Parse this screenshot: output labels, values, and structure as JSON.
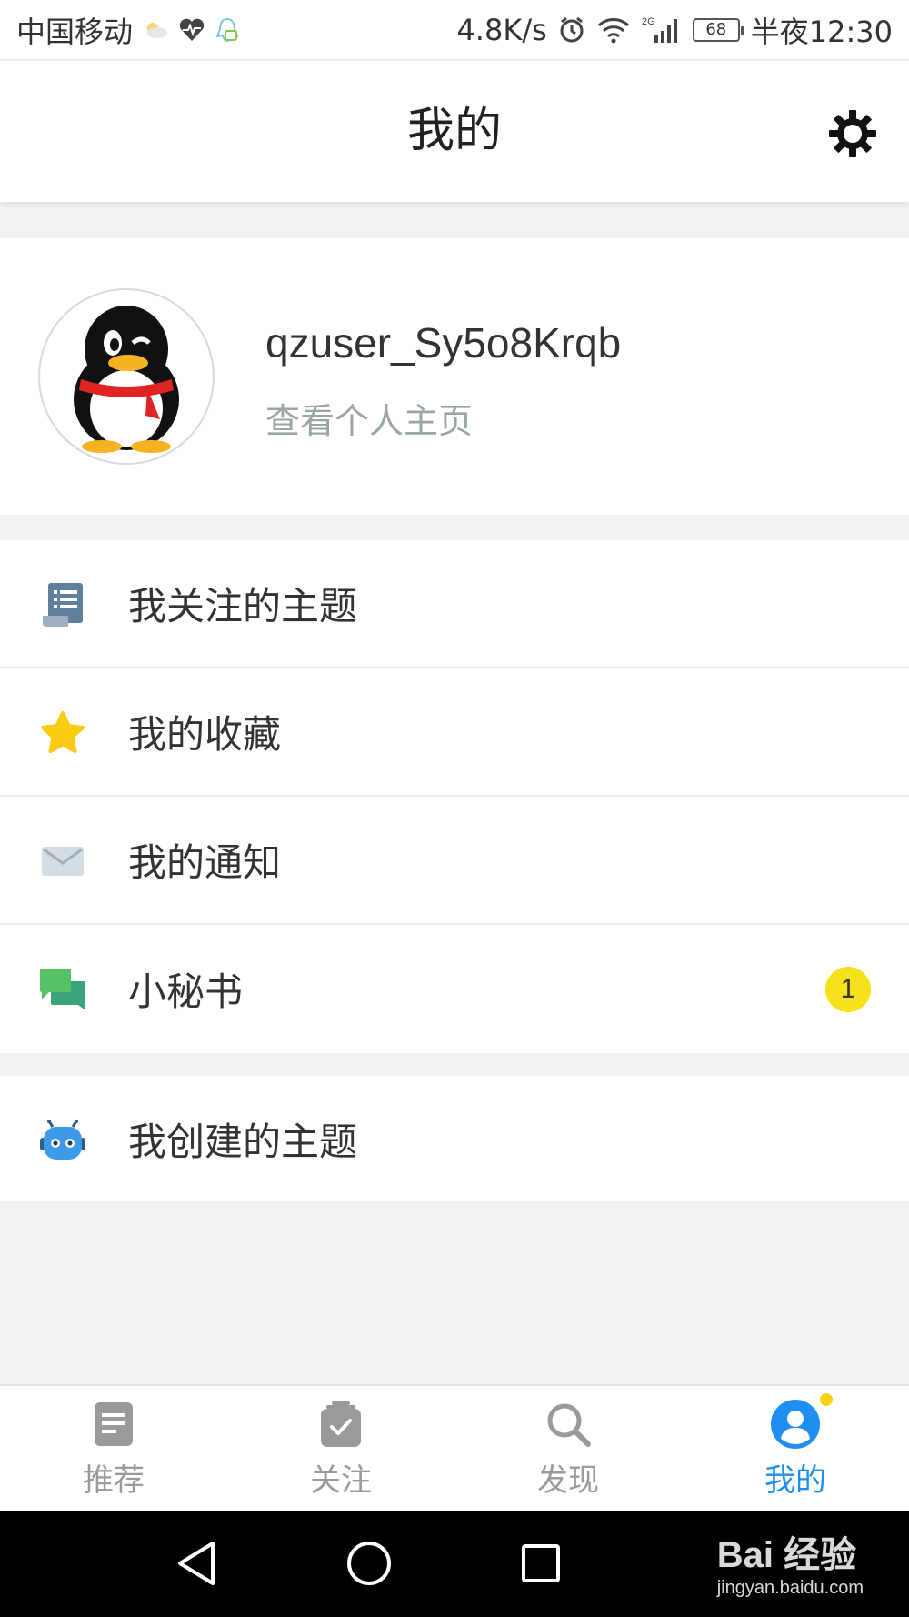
{
  "status_bar": {
    "carrier": "中国移动",
    "net_speed": "4.8K/s",
    "network_type": "2G",
    "battery": "68",
    "time": "半夜12:30",
    "icons": [
      "weather-icon",
      "heart-rate-icon",
      "qq-icon",
      "alarm-icon",
      "wifi-icon",
      "signal-icon"
    ]
  },
  "header": {
    "title": "我的",
    "settings_icon": "gear-icon"
  },
  "profile": {
    "username": "qzuser_Sy5o8Krqb",
    "link_text": "查看个人主页"
  },
  "menu": {
    "group1": [
      {
        "label": "我关注的主题",
        "icon": "document-list-icon"
      },
      {
        "label": "我的收藏",
        "icon": "star-icon"
      },
      {
        "label": "我的通知",
        "icon": "envelope-icon"
      },
      {
        "label": "小秘书",
        "icon": "chat-bubbles-icon",
        "badge": "1"
      }
    ],
    "group2": [
      {
        "label": "我创建的主题",
        "icon": "robot-icon"
      }
    ]
  },
  "tabs": [
    {
      "label": "推荐",
      "icon": "article-icon",
      "active": false
    },
    {
      "label": "关注",
      "icon": "clipboard-check-icon",
      "active": false
    },
    {
      "label": "发现",
      "icon": "search-icon",
      "active": false
    },
    {
      "label": "我的",
      "icon": "user-icon",
      "active": true
    }
  ],
  "watermark": {
    "main": "Bai 经验",
    "sub": "jingyan.baidu.com"
  },
  "colors": {
    "accent": "#1e8ff0",
    "badge": "#f7e11a",
    "page_bg": "#f1f2f4"
  }
}
